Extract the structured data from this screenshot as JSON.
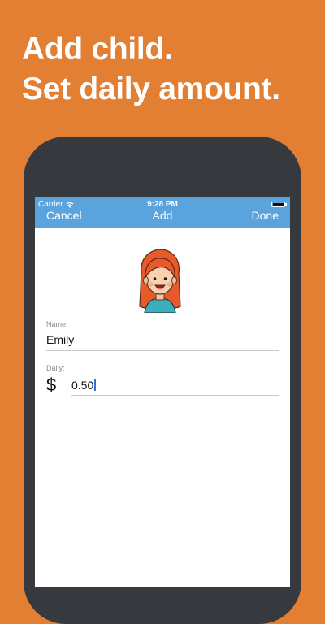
{
  "headline": {
    "line1": "Add child.",
    "line2": "Set daily amount."
  },
  "status_bar": {
    "carrier": "Carrier",
    "time": "9:28 PM"
  },
  "navbar": {
    "cancel_label": "Cancel",
    "title": "Add",
    "done_label": "Done"
  },
  "form": {
    "name_label": "Name:",
    "name_value": "Emily",
    "daily_label": "Daily:",
    "currency_symbol": "$",
    "daily_value": "0.50"
  },
  "colors": {
    "background": "#e37f33",
    "navbar": "#5aa3dc",
    "phone_frame": "#36393e"
  },
  "icons": [
    "wifi-icon",
    "battery-icon",
    "child-avatar"
  ]
}
